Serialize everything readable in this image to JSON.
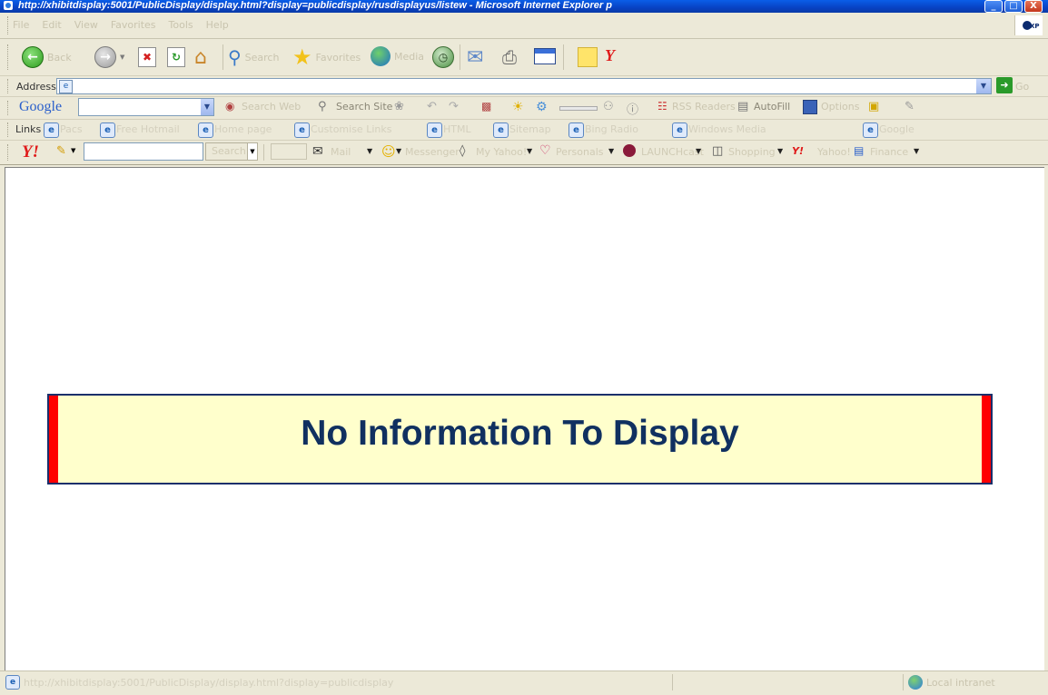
{
  "window": {
    "title": "http://xhibitdisplay:5001/PublicDisplay/display.html?display=publicdisplay/rusdisplayus/listew - Microsoft Internet Explorer p",
    "controls": [
      "_",
      "□",
      "X"
    ]
  },
  "menubar": {
    "items": [
      "File",
      "Edit",
      "View",
      "Favorites",
      "Tools",
      "Help"
    ],
    "brand_logo": "XP"
  },
  "toolbar": {
    "back_label": "Back",
    "forward_label": "",
    "search_label": "Search",
    "favorites_label": "Favorites",
    "media_label": "Media"
  },
  "address_bar": {
    "label": "Address",
    "url": "",
    "go_label": "Go"
  },
  "google_bar": {
    "logo": "Google",
    "search_site": "Search Site",
    "search_web": "Search Web",
    "rss": "RSS Readers",
    "autofill": "AutoFill",
    "options": "Options"
  },
  "links_bar": {
    "label": "Links",
    "items": [
      "Pacs",
      "Free Hotmail",
      "Home page",
      "Customise Links",
      "HTML",
      "Sitemap",
      "Bing Radio",
      "Windows Media",
      "Google"
    ]
  },
  "yahoo_bar": {
    "logo": "Y!",
    "search_button": "Search",
    "mail": "Mail",
    "messenger": "Messenger",
    "my_yahoo": "My Yahoo!",
    "personals": "Personals",
    "launchcast": "LAUNCHcast",
    "shopping": "Shopping",
    "yahoo_label": "Yahoo!",
    "finance": "Finance"
  },
  "banner": {
    "message": "No Information To Display",
    "colors": {
      "background": "#ffffcc",
      "accent": "#ff0000",
      "text": "#103060",
      "border": "#1a2f6b"
    }
  },
  "status_bar": {
    "text": "http://xhibitdisplay:5001/PublicDisplay/display.html?display=publicdisplay",
    "zone": "Local intranet"
  }
}
